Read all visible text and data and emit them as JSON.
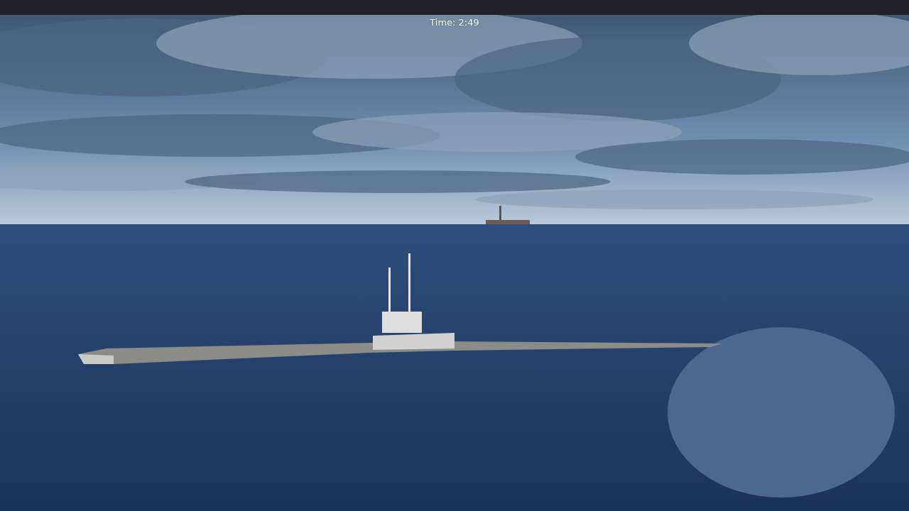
{
  "hud": {
    "time": "Time: 2:49"
  }
}
